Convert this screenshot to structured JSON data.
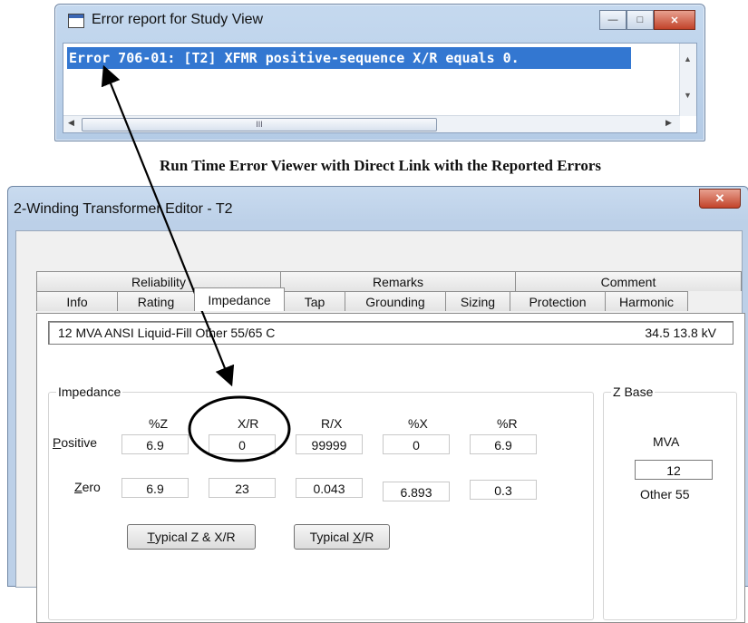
{
  "error_window": {
    "title": "Error report for Study View",
    "error_line": "Error  706-01:  [T2]  XFMR positive-sequence X/R equals 0.",
    "scroll_thumb_grip": "III",
    "controls": {
      "minimize": "—",
      "maximize": "□",
      "close": "✕"
    }
  },
  "caption": "Run Time Error Viewer with Direct Link with the Reported Errors",
  "editor": {
    "title": "2-Winding Transformer Editor - T2",
    "close": "✕",
    "tabs_top": [
      "Reliability",
      "Remarks",
      "Comment"
    ],
    "tabs_bottom": [
      "Info",
      "Rating",
      "Impedance",
      "Tap",
      "Grounding",
      "Sizing",
      "Protection",
      "Harmonic"
    ],
    "active_tab": "Impedance",
    "summary": {
      "left": "12 MVA  ANSI  Liquid-Fill  Other  55/65 C",
      "right": "34.5   13.8 kV"
    },
    "impedance": {
      "group_title": "Impedance",
      "headers": [
        "%Z",
        "X/R",
        "R/X",
        "%X",
        "%R"
      ],
      "positive": {
        "label_u": "P",
        "label_rest": "ositive",
        "values": [
          "6.9",
          "0",
          "99999",
          "0",
          "6.9"
        ]
      },
      "zero": {
        "label_u": "Z",
        "label_rest": "ero",
        "values": [
          "6.9",
          "23",
          "0.043",
          "6.893",
          "0.3"
        ]
      },
      "btn_typical_z": {
        "pre": "",
        "u": "T",
        "post": "ypical Z & X/R"
      },
      "btn_typical_xr": {
        "pre": "Typical ",
        "u": "X",
        "post": "/R"
      }
    },
    "zbase": {
      "group_title": "Z Base",
      "mva_label": "MVA",
      "mva_value": "12",
      "note": "Other 55"
    }
  }
}
